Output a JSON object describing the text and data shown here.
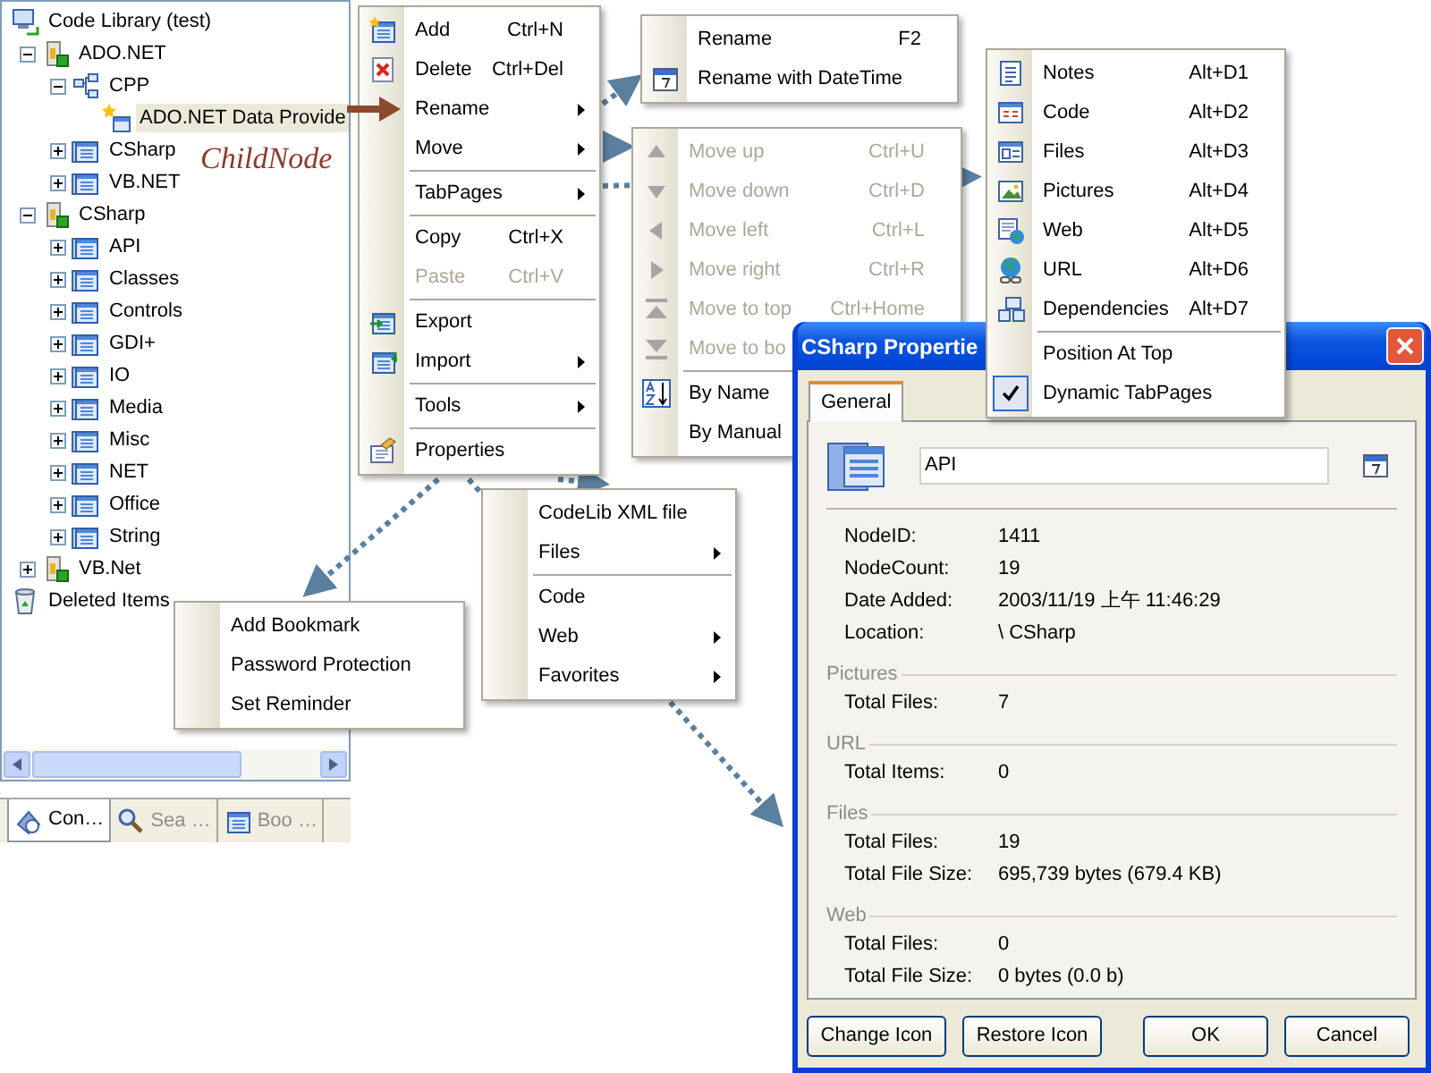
{
  "tree": {
    "nodes": [
      {
        "kind": "root",
        "label": "Code Library (test)",
        "selected": false,
        "children": [
          {
            "kind": "library",
            "label": "ADO.NET",
            "expanded": true,
            "selected": false,
            "children": [
              {
                "kind": "folder",
                "label": "CPP",
                "expanded": true,
                "selected": false,
                "children": [
                  {
                    "kind": "item",
                    "label": "ADO.NET Data Provide",
                    "selected": true
                  }
                ]
              },
              {
                "kind": "category",
                "label": "CSharp",
                "expanded": false,
                "selected": false
              },
              {
                "kind": "category",
                "label": "VB.NET",
                "expanded": false,
                "selected": false
              }
            ]
          },
          {
            "kind": "library",
            "label": "CSharp",
            "expanded": true,
            "selected": false,
            "children": [
              {
                "kind": "category",
                "label": "API",
                "expanded": false,
                "selected": false
              },
              {
                "kind": "category",
                "label": "Classes",
                "expanded": false,
                "selected": false
              },
              {
                "kind": "category",
                "label": "Controls",
                "expanded": false,
                "selected": false
              },
              {
                "kind": "category",
                "label": "GDI+",
                "expanded": false,
                "selected": false
              },
              {
                "kind": "category",
                "label": "IO",
                "expanded": false,
                "selected": false
              },
              {
                "kind": "category",
                "label": "Media",
                "expanded": false,
                "selected": false
              },
              {
                "kind": "category",
                "label": "Misc",
                "expanded": false,
                "selected": false
              },
              {
                "kind": "category",
                "label": "NET",
                "expanded": false,
                "selected": false
              },
              {
                "kind": "category",
                "label": "Office",
                "expanded": false,
                "selected": false
              },
              {
                "kind": "category",
                "label": "String",
                "expanded": false,
                "selected": false
              }
            ]
          },
          {
            "kind": "library",
            "label": "VB.Net",
            "expanded": false,
            "selected": false
          }
        ]
      },
      {
        "kind": "trash",
        "label": "Deleted Items",
        "selected": false
      }
    ]
  },
  "bottom_tabs": [
    {
      "label": "Con…",
      "selected": true
    },
    {
      "label": "Sea …",
      "selected": false
    },
    {
      "label": "Boo …",
      "selected": false
    }
  ],
  "annotation": {
    "text": "ChildNode"
  },
  "context_menu": {
    "items": [
      {
        "kind": "item",
        "label": "Add",
        "shortcut": "Ctrl+N",
        "disabled": false,
        "submenu": false
      },
      {
        "kind": "item",
        "label": "Delete",
        "shortcut": "Ctrl+Del",
        "disabled": false,
        "submenu": false
      },
      {
        "kind": "item",
        "label": "Rename",
        "disabled": false,
        "submenu": true
      },
      {
        "kind": "item",
        "label": "Move",
        "disabled": false,
        "submenu": true
      },
      {
        "kind": "separator"
      },
      {
        "kind": "item",
        "label": "TabPages",
        "disabled": false,
        "submenu": true
      },
      {
        "kind": "separator"
      },
      {
        "kind": "item",
        "label": "Copy",
        "shortcut": "Ctrl+X",
        "disabled": false,
        "submenu": false
      },
      {
        "kind": "item",
        "label": "Paste",
        "shortcut": "Ctrl+V",
        "disabled": true,
        "submenu": false
      },
      {
        "kind": "separator"
      },
      {
        "kind": "item",
        "label": "Export",
        "disabled": false,
        "submenu": false
      },
      {
        "kind": "item",
        "label": "Import",
        "disabled": false,
        "submenu": true
      },
      {
        "kind": "separator"
      },
      {
        "kind": "item",
        "label": "Tools",
        "disabled": false,
        "submenu": true
      },
      {
        "kind": "separator"
      },
      {
        "kind": "item",
        "label": "Properties",
        "disabled": false,
        "submenu": false
      }
    ]
  },
  "rename_menu": {
    "items": [
      {
        "kind": "item",
        "label": "Rename",
        "shortcut": "F2"
      },
      {
        "kind": "item",
        "label": "Rename with DateTime"
      }
    ]
  },
  "move_menu": {
    "items": [
      {
        "kind": "item",
        "label": "Move up",
        "shortcut": "Ctrl+U",
        "disabled": true
      },
      {
        "kind": "item",
        "label": "Move down",
        "shortcut": "Ctrl+D",
        "disabled": true
      },
      {
        "kind": "item",
        "label": "Move left",
        "shortcut": "Ctrl+L",
        "disabled": true
      },
      {
        "kind": "item",
        "label": "Move right",
        "shortcut": "Ctrl+R",
        "disabled": true
      },
      {
        "kind": "item",
        "label": "Move to top",
        "shortcut": "Ctrl+Home",
        "disabled": true
      },
      {
        "kind": "item",
        "label": "Move to bo",
        "disabled": true
      },
      {
        "kind": "separator"
      },
      {
        "kind": "item",
        "label": "By Name",
        "disabled": false
      },
      {
        "kind": "item",
        "label": "By Manual",
        "disabled": false
      }
    ]
  },
  "tabpages_menu": {
    "items": [
      {
        "kind": "item",
        "label": "Notes",
        "shortcut": "Alt+D1",
        "checked": false
      },
      {
        "kind": "item",
        "label": "Code",
        "shortcut": "Alt+D2",
        "checked": false
      },
      {
        "kind": "item",
        "label": "Files",
        "shortcut": "Alt+D3",
        "checked": false
      },
      {
        "kind": "item",
        "label": "Pictures",
        "shortcut": "Alt+D4",
        "checked": false
      },
      {
        "kind": "item",
        "label": "Web",
        "shortcut": "Alt+D5",
        "checked": false
      },
      {
        "kind": "item",
        "label": "URL",
        "shortcut": "Alt+D6",
        "checked": false
      },
      {
        "kind": "item",
        "label": "Dependencies",
        "shortcut": "Alt+D7",
        "checked": false
      },
      {
        "kind": "separator"
      },
      {
        "kind": "item",
        "label": "Position At Top",
        "checked": false
      },
      {
        "kind": "item",
        "label": "Dynamic TabPages",
        "checked": true
      }
    ]
  },
  "import_menu": {
    "items": [
      {
        "kind": "item",
        "label": "CodeLib XML file",
        "submenu": false
      },
      {
        "kind": "item",
        "label": "Files",
        "submenu": true
      },
      {
        "kind": "separator"
      },
      {
        "kind": "item",
        "label": "Code",
        "submenu": false
      },
      {
        "kind": "item",
        "label": "Web",
        "submenu": true
      },
      {
        "kind": "item",
        "label": "Favorites",
        "submenu": true
      }
    ]
  },
  "tools_menu": {
    "items": [
      {
        "kind": "item",
        "label": "Add Bookmark"
      },
      {
        "kind": "item",
        "label": "Password Protection"
      },
      {
        "kind": "item",
        "label": "Set Reminder"
      }
    ]
  },
  "properties": {
    "title": "CSharp Propertie",
    "tabs": [
      {
        "label": "General",
        "selected": true
      }
    ],
    "name_field": {
      "value": "API"
    },
    "info": [
      {
        "label": "NodeID:",
        "value": "1411"
      },
      {
        "label": "NodeCount:",
        "value": "19"
      },
      {
        "label": "Date Added:",
        "value": "2003/11/19 上午 11:46:29"
      },
      {
        "label": "Location:",
        "value": "\\ CSharp"
      }
    ],
    "sections": [
      {
        "title": "Pictures",
        "rows": [
          {
            "label": "Total Files:",
            "value": "7"
          }
        ]
      },
      {
        "title": "URL",
        "rows": [
          {
            "label": "Total Items:",
            "value": "0"
          }
        ]
      },
      {
        "title": "Files",
        "rows": [
          {
            "label": "Total Files:",
            "value": "19"
          },
          {
            "label": "Total File Size:",
            "value": "695,739 bytes (679.4 KB)"
          }
        ]
      },
      {
        "title": "Web",
        "rows": [
          {
            "label": "Total Files:",
            "value": "0"
          },
          {
            "label": "Total File Size:",
            "value": "0 bytes (0.0 b)"
          }
        ]
      }
    ],
    "buttons": [
      "Change Icon",
      "Restore Icon",
      "OK",
      "Cancel"
    ]
  }
}
